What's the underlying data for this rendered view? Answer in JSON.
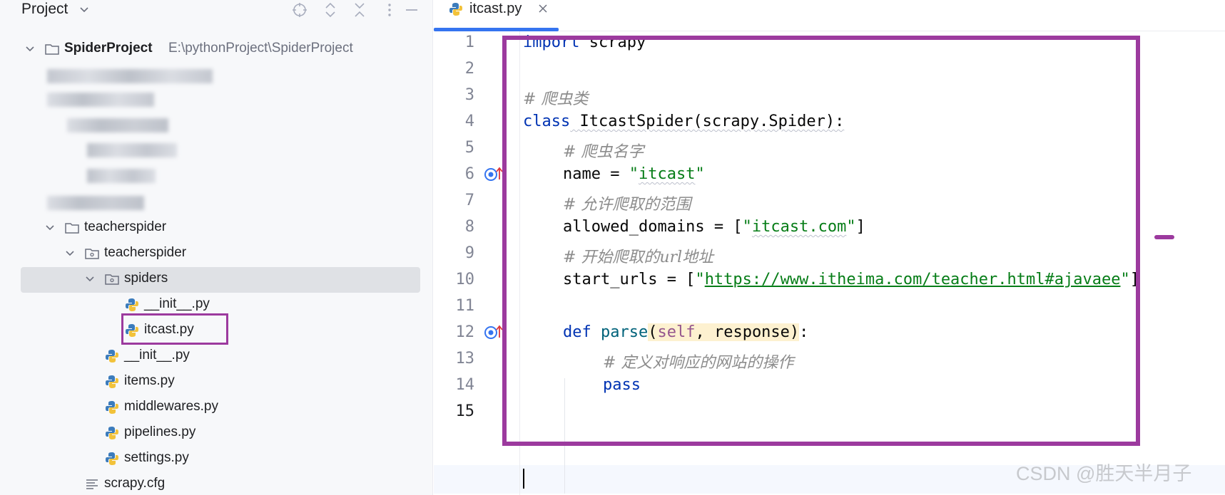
{
  "project_panel": {
    "title": "Project",
    "root": {
      "name": "SpiderProject",
      "path": "E:\\pythonProject\\SpiderProject"
    },
    "tree": [
      {
        "label": "teacherspider",
        "icon": "folder-icon"
      },
      {
        "label": "teacherspider",
        "icon": "package-folder-icon"
      },
      {
        "label": "spiders",
        "icon": "package-folder-icon",
        "selected": true
      },
      {
        "label": "__init__.py",
        "icon": "python-file-icon"
      },
      {
        "label": "itcast.py",
        "icon": "python-file-icon"
      },
      {
        "label": "__init__.py",
        "icon": "python-file-icon"
      },
      {
        "label": "items.py",
        "icon": "python-file-icon"
      },
      {
        "label": "middlewares.py",
        "icon": "python-file-icon"
      },
      {
        "label": "pipelines.py",
        "icon": "python-file-icon"
      },
      {
        "label": "settings.py",
        "icon": "python-file-icon"
      },
      {
        "label": "scrapy.cfg",
        "icon": "text-file-icon"
      }
    ]
  },
  "editor": {
    "tab": {
      "label": "itcast.py"
    },
    "line_numbers": [
      "1",
      "2",
      "3",
      "4",
      "5",
      "6",
      "7",
      "8",
      "9",
      "10",
      "11",
      "12",
      "13",
      "14",
      "15"
    ],
    "code": {
      "l1_kw": "import",
      "l1_rest": " scrapy",
      "l3_comment": "# 爬虫类",
      "l4_kw": "class",
      "l4_rest": " ItcastSpider(scrapy.Spider):",
      "l5_comment": "# 爬虫名字",
      "l6_name": "name = ",
      "l6_q1": "\"",
      "l6_val": "itcast",
      "l6_q2": "\"",
      "l7_comment": "# 允许爬取的范围",
      "l8_name": "allowed_domains = [",
      "l8_q1": "\"",
      "l8_val": "itcast.com",
      "l8_q2": "\"",
      "l8_end": "]",
      "l9_comment": "# 开始爬取的url地址",
      "l10_name": "start_urls = [",
      "l10_q1": "\"",
      "l10_val": "https://www.itheima.com/teacher.html#ajavaee",
      "l10_q2": "\"",
      "l10_end": "]",
      "l12_kw": "def",
      "l12_fn": "parse",
      "l12_open": "(",
      "l12_self": "self",
      "l12_args": ", response",
      "l12_close": ")",
      "l12_colon": ":",
      "l13_comment": "# 定义对响应的网站的操作",
      "l14_kw": "pass"
    }
  },
  "watermark": "CSDN @胜天半月子",
  "colors": {
    "highlight_box": "#9c3a9e",
    "tab_accent": "#3574f0",
    "keyword": "#0033b3",
    "string": "#067d17"
  }
}
